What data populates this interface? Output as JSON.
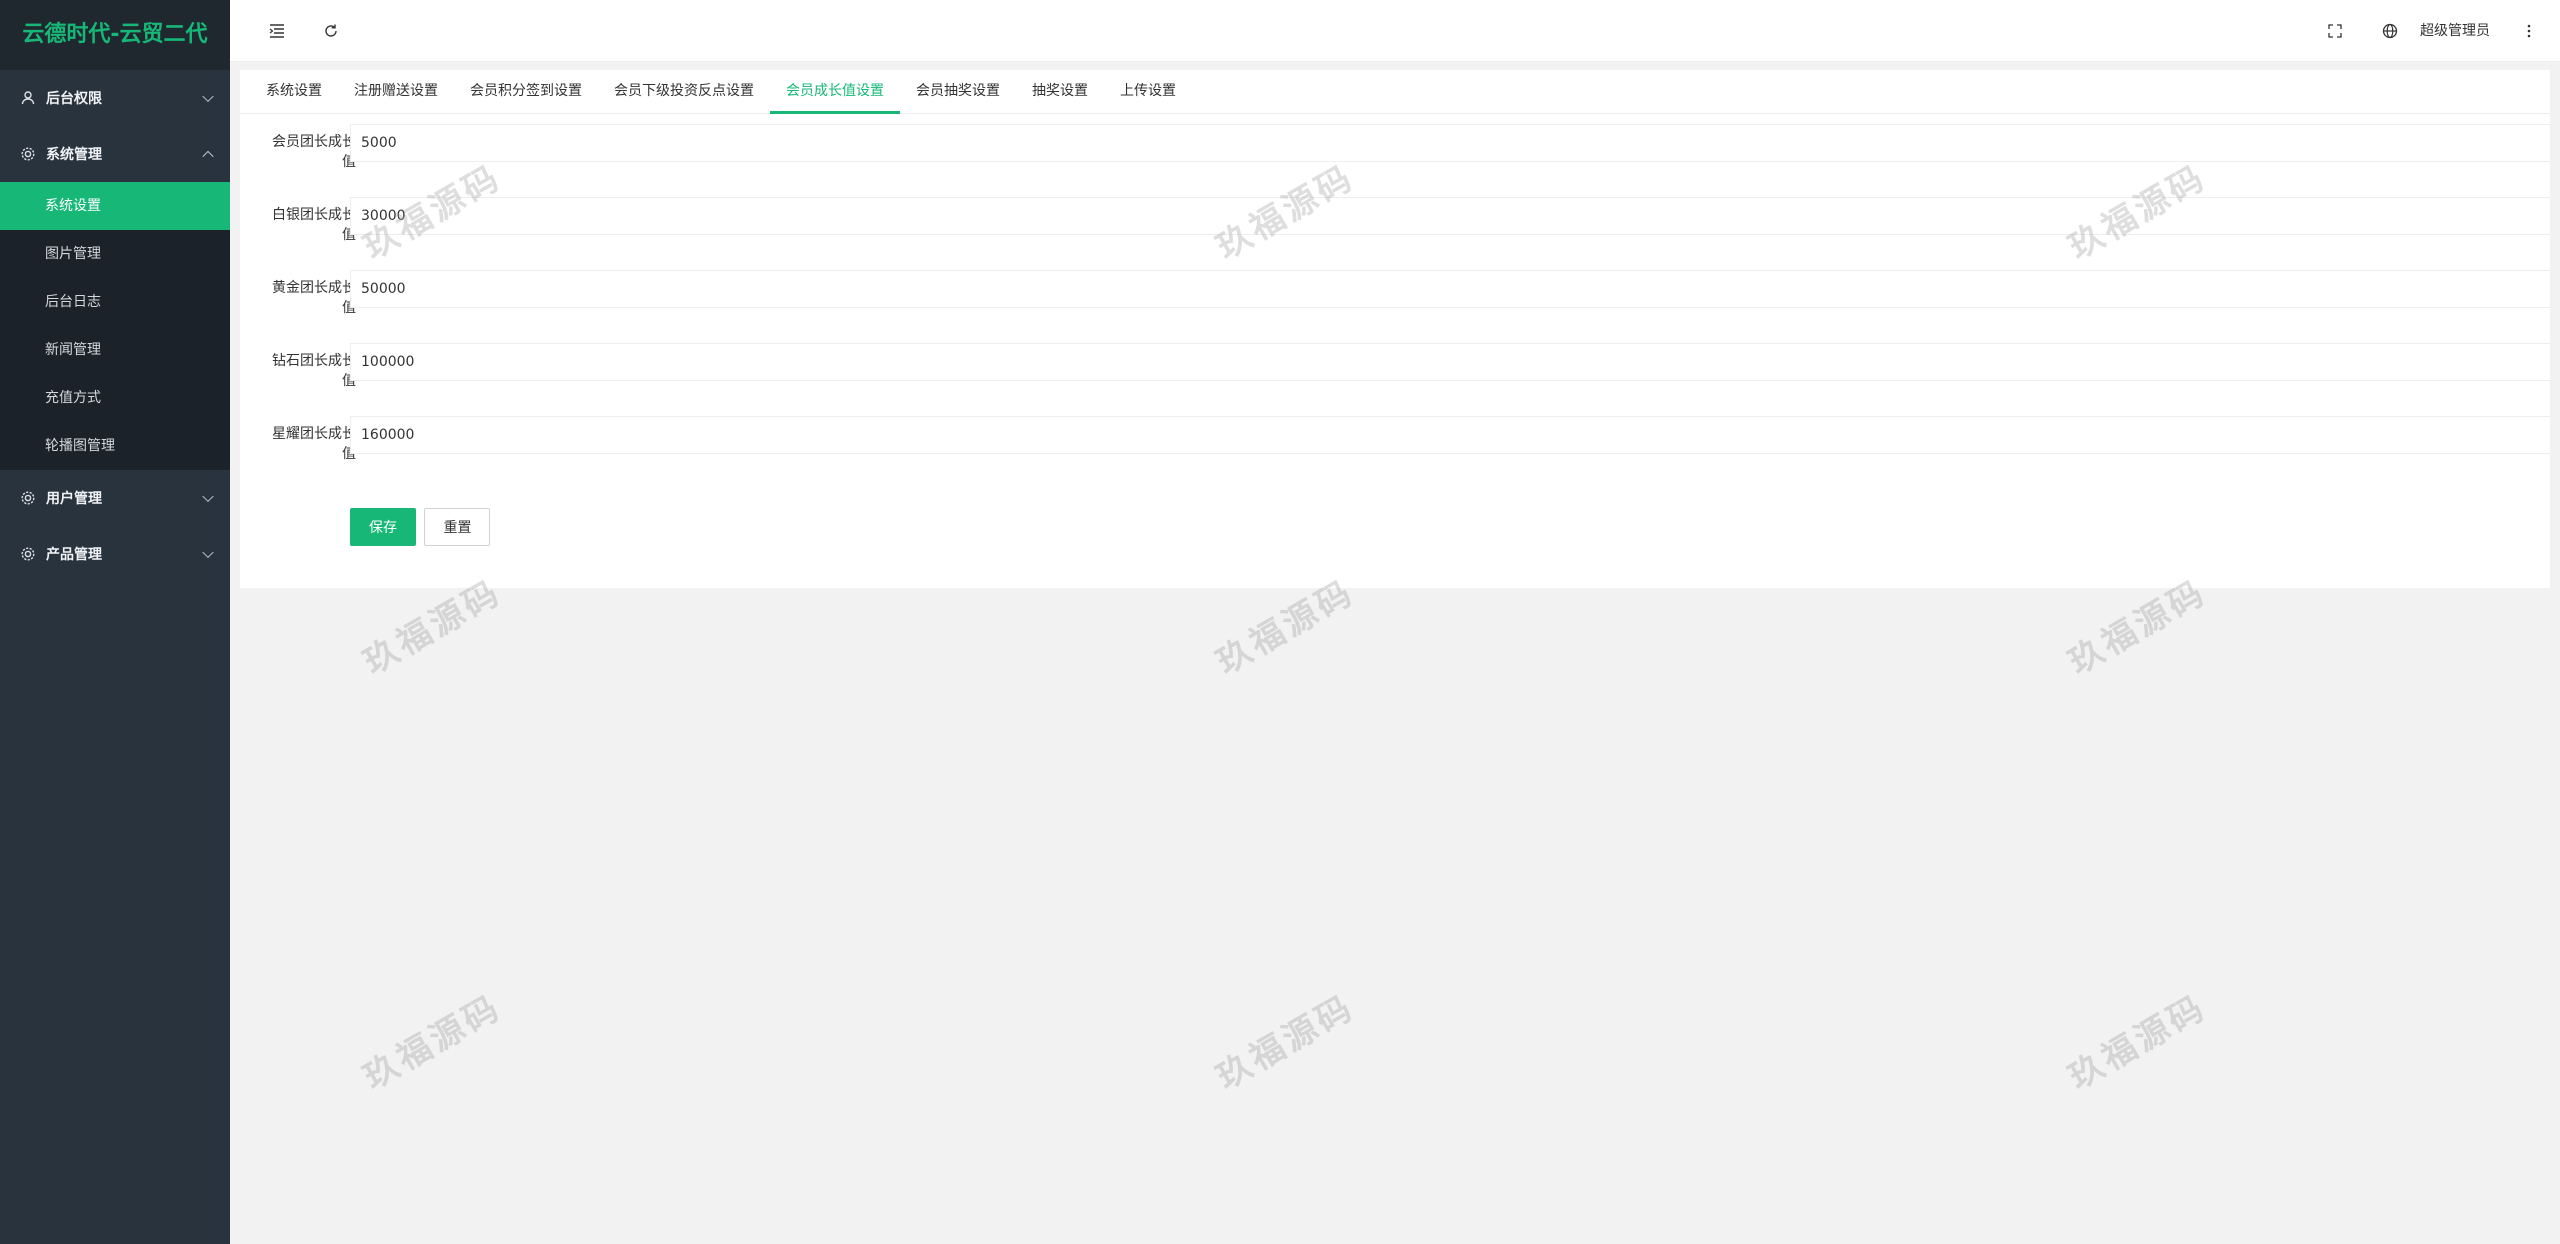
{
  "app": {
    "title": "云德时代-云贸二代"
  },
  "sidebar": {
    "groups": [
      {
        "label": "后台权限",
        "icon": "user-icon",
        "expanded": false
      },
      {
        "label": "系统管理",
        "icon": "gear-icon",
        "expanded": true,
        "items": [
          {
            "label": "系统设置",
            "active": true
          },
          {
            "label": "图片管理"
          },
          {
            "label": "后台日志"
          },
          {
            "label": "新闻管理"
          },
          {
            "label": "充值方式"
          },
          {
            "label": "轮播图管理"
          }
        ]
      },
      {
        "label": "用户管理",
        "icon": "gear-icon",
        "expanded": false
      },
      {
        "label": "产品管理",
        "icon": "gear-icon",
        "expanded": false
      }
    ]
  },
  "header": {
    "user": "超级管理员",
    "icons": [
      "menu-toggle-icon",
      "refresh-icon",
      "fullscreen-icon",
      "language-icon",
      "more-icon"
    ]
  },
  "tabs": [
    {
      "label": "系统设置"
    },
    {
      "label": "注册赠送设置"
    },
    {
      "label": "会员积分签到设置"
    },
    {
      "label": "会员下级投资反点设置"
    },
    {
      "label": "会员成长值设置",
      "active": true
    },
    {
      "label": "会员抽奖设置"
    },
    {
      "label": "抽奖设置"
    },
    {
      "label": "上传设置"
    }
  ],
  "form": {
    "fields": [
      {
        "label": "会员团长成长值",
        "value": "5000"
      },
      {
        "label": "白银团长成长值",
        "value": "30000"
      },
      {
        "label": "黄金团长成长值",
        "value": "50000"
      },
      {
        "label": "钻石团长成长值",
        "value": "100000"
      },
      {
        "label": "星耀团长成长值",
        "value": "160000"
      }
    ],
    "save_label": "保存",
    "reset_label": "重置"
  },
  "watermark": "玖福源码",
  "colors": {
    "accent": "#16b777",
    "sidebar_bg": "#28333e",
    "sidebar_dark": "#1b2229"
  }
}
